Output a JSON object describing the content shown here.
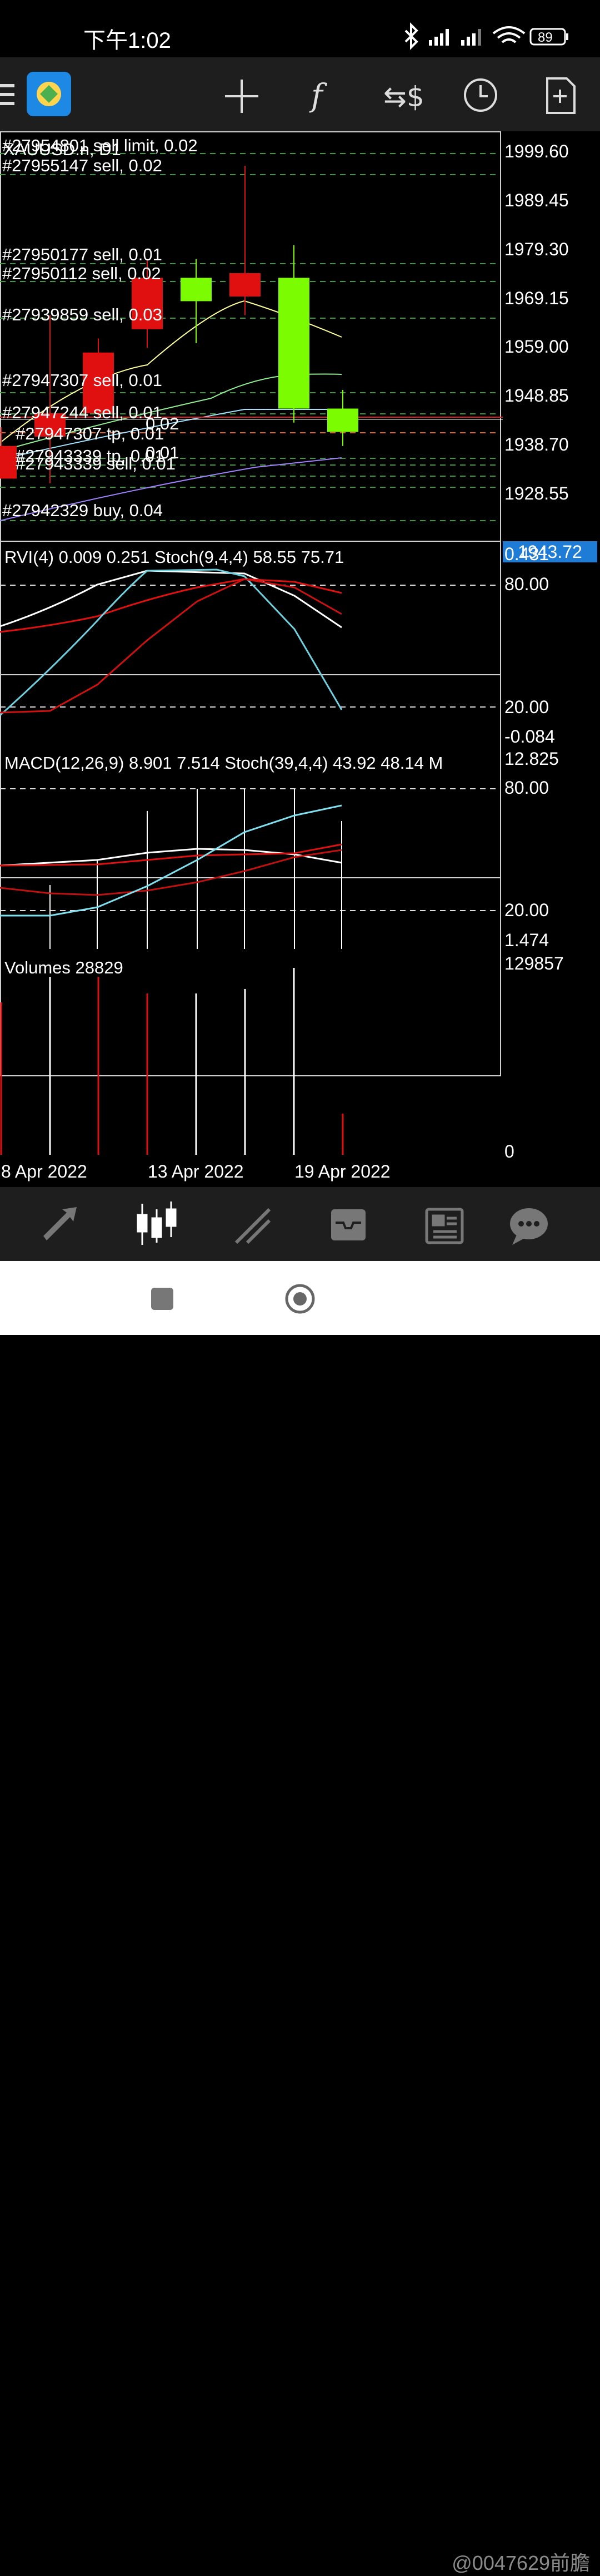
{
  "status_bar": {
    "time": "下午1:02",
    "battery": "89"
  },
  "toolbar": {
    "icons": [
      "menu-icon",
      "app-logo-icon",
      "crosshair-icon",
      "indicators-icon",
      "symbol-change-icon",
      "timeframe-icon",
      "new-order-icon"
    ]
  },
  "chart": {
    "symbol": "XAUUSD.n, D1",
    "price_labels": [
      "1999.60",
      "1989.45",
      "1979.30",
      "1969.15",
      "1959.00",
      "1948.85",
      "1938.70",
      "1928.55"
    ],
    "current_price": "1943.72",
    "orders": [
      "#27954801 sell limit, 0.02",
      "#27955147 sell, 0.02",
      "#27950177 sell, 0.01",
      "#27950112 sell, 0.02",
      "#27939859 sell, 0.03",
      "#27947307 sell, 0.01",
      "#27947244 sell, 0.01",
      "0.02",
      "#27947307 tp, 0.01",
      "0.01",
      "#27943339 tp, 0.01",
      "#27943339 sell, 0.01",
      "#27942329 buy, 0.04"
    ],
    "dates": [
      "8 Apr 2022",
      "13 Apr 2022",
      "19 Apr 2022"
    ]
  },
  "chart_data": {
    "type": "candlestick",
    "symbol": "XAUUSD.n, D1",
    "candles": [
      {
        "open": 1938,
        "high": 1942,
        "low": 1931,
        "close": 1931
      },
      {
        "open": 1945,
        "high": 1966,
        "low": 1930,
        "close": 1940
      },
      {
        "open": 1958,
        "high": 1961,
        "low": 1944,
        "close": 1945
      },
      {
        "open": 1974,
        "high": 1978,
        "low": 1959,
        "close": 1963
      },
      {
        "open": 1969,
        "high": 1978,
        "low": 1960,
        "close": 1974
      },
      {
        "open": 1975,
        "high": 1998,
        "low": 1966,
        "close": 1970
      },
      {
        "open": 1946,
        "high": 1981,
        "low": 1943,
        "close": 1974
      },
      {
        "open": 1941,
        "high": 1950,
        "low": 1938,
        "close": 1946
      }
    ],
    "ylim": [
      1922,
      2003
    ],
    "y_ticks": [
      "1999.60",
      "1989.45",
      "1979.30",
      "1969.15",
      "1959.00",
      "1948.85",
      "1938.70",
      "1928.55"
    ],
    "indicators": {
      "rvi": {
        "label": "RVI(4) 0.009 0.251",
        "values_hi": "0.431",
        "values_lo": "-0.084"
      },
      "stoch1": {
        "label": "Stoch(9,4,4) 58.55 75.71",
        "levels": [
          "80.00",
          "20.00"
        ]
      },
      "macd": {
        "label": "MACD(12,26,9) 8.901 7.514",
        "hi": "12.825",
        "lo": "1.474"
      },
      "stoch2": {
        "label": "Stoch(39,4,4) 43.92 48.14 M",
        "levels": [
          "80.00",
          "20.00"
        ]
      },
      "volumes": {
        "label": "Volumes 28829",
        "hi": "129857",
        "lo": "0"
      }
    },
    "colors": {
      "bull": "#7cfc00",
      "bear": "#e01010",
      "price_line": "#e02020",
      "price_tag": "#1e7bd6"
    }
  },
  "bottom_nav": [
    "quotes-icon",
    "chart-icon",
    "trade-icon",
    "history-icon",
    "news-icon",
    "chat-icon"
  ],
  "watermark": "@0047629前膽"
}
